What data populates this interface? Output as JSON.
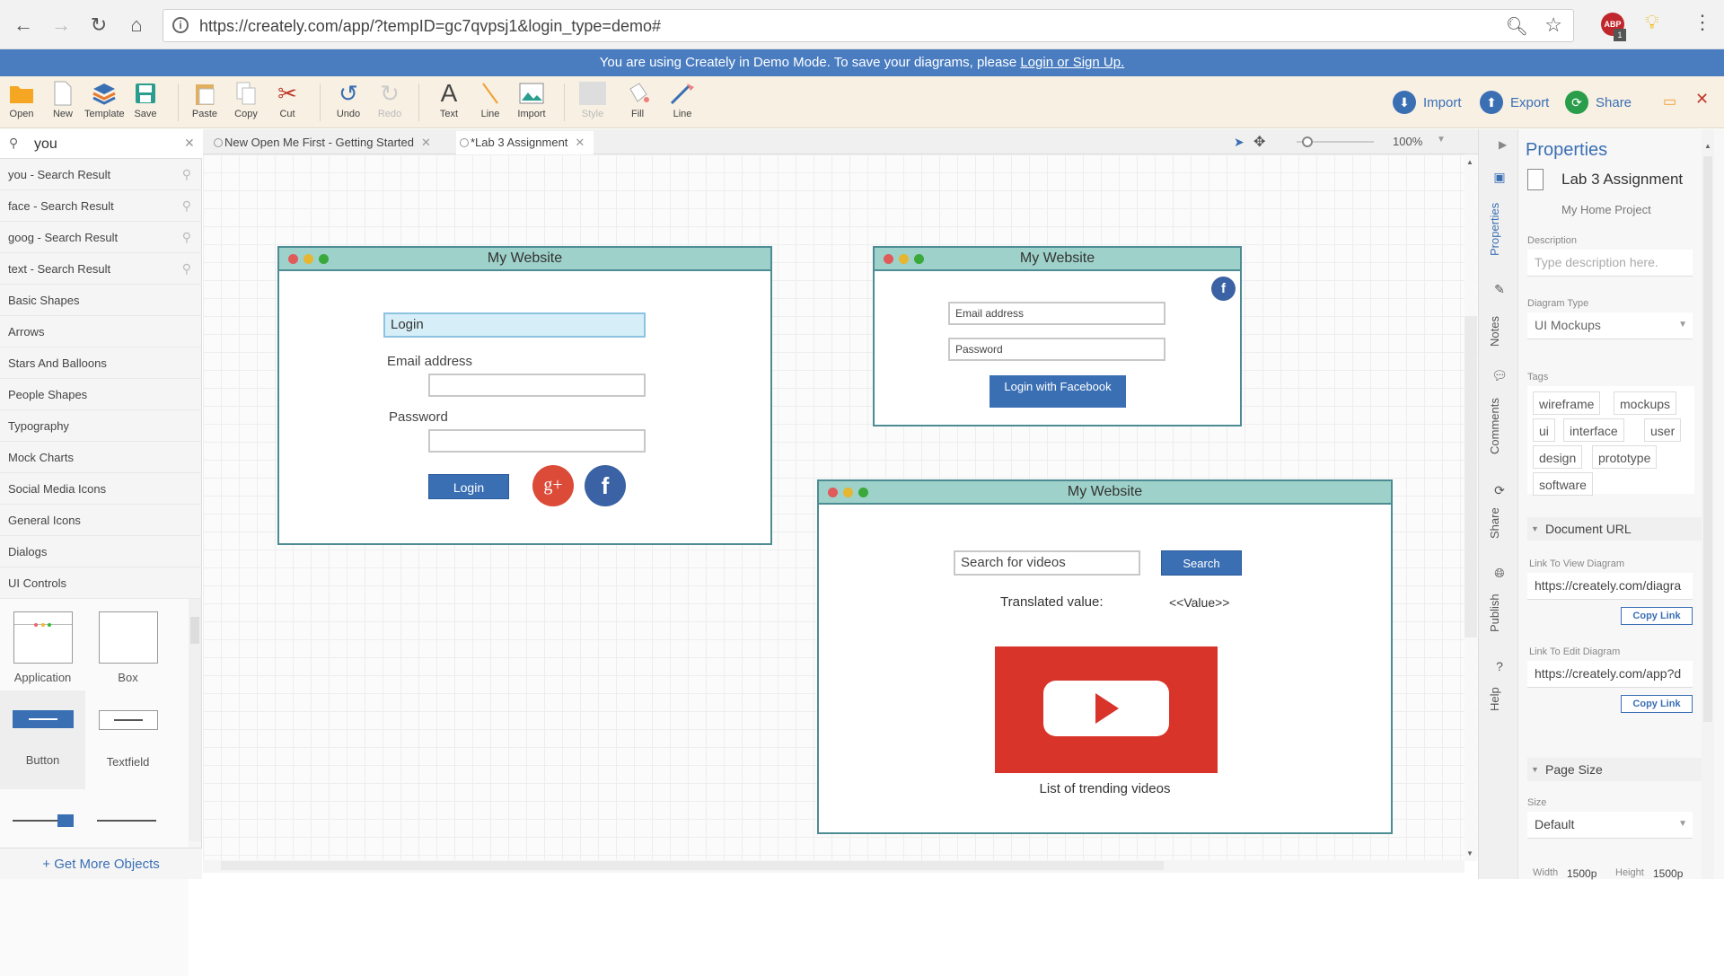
{
  "browser": {
    "url_host": "https://creately.com",
    "url_path": "/app/?tempID=gc7qvpsj1&login_type=demo#",
    "ext_badge": "1"
  },
  "banner": {
    "text": "You are using Creately in Demo Mode. To save your diagrams, please ",
    "link": "Login or Sign Up."
  },
  "toolbar": {
    "open": "Open",
    "new": "New",
    "template": "Template",
    "save": "Save",
    "paste": "Paste",
    "copy": "Copy",
    "cut": "Cut",
    "undo": "Undo",
    "redo": "Redo",
    "text": "Text",
    "line": "Line",
    "import": "Import",
    "style": "Style",
    "fill": "Fill",
    "line2": "Line",
    "import_btn": "Import",
    "export_btn": "Export",
    "share_btn": "Share"
  },
  "library": {
    "search_value": "you",
    "items": [
      {
        "label": "you - Search Result",
        "search": true
      },
      {
        "label": "face - Search Result",
        "search": true
      },
      {
        "label": "goog - Search Result",
        "search": true
      },
      {
        "label": "text - Search Result",
        "search": true
      },
      {
        "label": "Basic Shapes",
        "search": false
      },
      {
        "label": "Arrows",
        "search": false
      },
      {
        "label": "Stars And Balloons",
        "search": false
      },
      {
        "label": "People Shapes",
        "search": false
      },
      {
        "label": "Typography",
        "search": false
      },
      {
        "label": "Mock Charts",
        "search": false
      },
      {
        "label": "Social Media Icons",
        "search": false
      },
      {
        "label": "General Icons",
        "search": false
      },
      {
        "label": "Dialogs",
        "search": false
      },
      {
        "label": "UI Controls",
        "search": false
      }
    ],
    "shapes": [
      "Application",
      "Box",
      "Button",
      "Textfield"
    ],
    "more": "+ Get More Objects"
  },
  "tabs": [
    {
      "label": "New Open Me First - Getting Started"
    },
    {
      "label": "*Lab 3 Assignment"
    }
  ],
  "zoom": "100%",
  "canvas": {
    "win1": {
      "title": "My Website",
      "login_field": "Login",
      "email_label": "Email address",
      "password_label": "Password",
      "login_btn": "Login",
      "gplus": "g+",
      "fb": "f"
    },
    "win2": {
      "title": "My Website",
      "fb": "f",
      "email_ph": "Email address",
      "password_ph": "Password",
      "fb_btn": "Login with Facebook"
    },
    "win3": {
      "title": "My Website",
      "search_ph": "Search for videos",
      "search_btn": "Search",
      "translated_label": "Translated value:",
      "value": "<<Value>>",
      "trending": "List of trending videos"
    }
  },
  "vtabs": [
    "Properties",
    "Notes",
    "Comments",
    "Share",
    "Publish",
    "Help"
  ],
  "properties": {
    "title": "Properties",
    "doc_name": "Lab 3 Assignment",
    "project": "My Home Project",
    "description_label": "Description",
    "description_ph": "Type description here.",
    "diagram_type_label": "Diagram Type",
    "diagram_type": "UI Mockups",
    "tags_label": "Tags",
    "tags": [
      "wireframe",
      "mockups",
      "ui",
      "interface",
      "user",
      "design",
      "prototype",
      "software"
    ],
    "doc_url": "Document URL",
    "view_label": "Link To View Diagram",
    "view_url": "https://creately.com/diagra",
    "edit_label": "Link To Edit Diagram",
    "edit_url": "https://creately.com/app?d",
    "copy_link": "Copy Link",
    "page_size": "Page Size",
    "size_label": "Size",
    "size_value": "Default",
    "width_label": "Width",
    "width_value": "1500p",
    "height_label": "Height",
    "height_value": "1500p"
  },
  "colors": {
    "accent": "#3a6fb4",
    "banner": "#4a7dc0",
    "titlebar": "#9ed1c9",
    "youtube": "#d8342a",
    "gplus": "#dc4a38"
  }
}
